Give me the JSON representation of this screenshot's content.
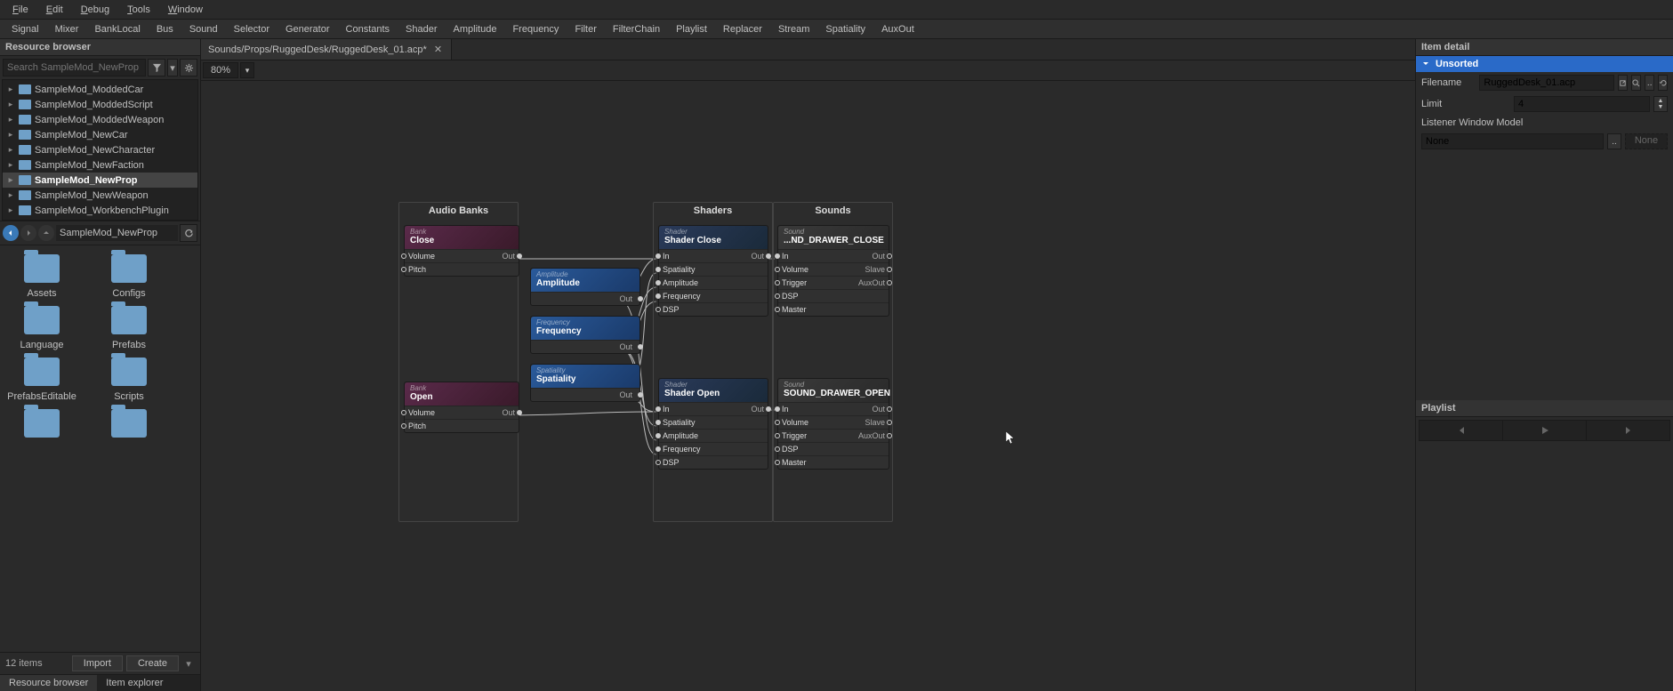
{
  "menu": {
    "file": "File",
    "edit": "Edit",
    "debug": "Debug",
    "tools": "Tools",
    "window": "Window"
  },
  "toolbar": [
    "Signal",
    "Mixer",
    "BankLocal",
    "Bus",
    "Sound",
    "Selector",
    "Generator",
    "Constants",
    "Shader",
    "Amplitude",
    "Frequency",
    "Filter",
    "FilterChain",
    "Playlist",
    "Replacer",
    "Stream",
    "Spatiality",
    "AuxOut"
  ],
  "left": {
    "panel_title": "Resource browser",
    "search_placeholder": "Search SampleMod_NewProp",
    "treeitems": [
      {
        "label": "SampleMod_ModdedCar",
        "sel": false
      },
      {
        "label": "SampleMod_ModdedScript",
        "sel": false
      },
      {
        "label": "SampleMod_ModdedWeapon",
        "sel": false
      },
      {
        "label": "SampleMod_NewCar",
        "sel": false
      },
      {
        "label": "SampleMod_NewCharacter",
        "sel": false
      },
      {
        "label": "SampleMod_NewFaction",
        "sel": false
      },
      {
        "label": "SampleMod_NewProp",
        "sel": true
      },
      {
        "label": "SampleMod_NewWeapon",
        "sel": false
      },
      {
        "label": "SampleMod_WorkbenchPlugin",
        "sel": false
      }
    ],
    "path": "SampleMod_NewProp",
    "folders": [
      "Assets",
      "Configs",
      "Language",
      "Prefabs",
      "PrefabsEditable",
      "Scripts"
    ],
    "count": "12 items",
    "import": "Import",
    "create": "Create",
    "tabs": {
      "rb": "Resource browser",
      "ie": "Item explorer"
    }
  },
  "center": {
    "tabpath": "Sounds/Props/RuggedDesk/RuggedDesk_01.acp*",
    "zoom": "80%",
    "groups": {
      "banks": "Audio Banks",
      "shaders": "Shaders",
      "sounds": "Sounds"
    },
    "nodes": {
      "bank_close": {
        "type": "Bank",
        "title": "Close",
        "rows": [
          {
            "l": "Volume",
            "r": "Out"
          },
          {
            "l": "Pitch",
            "r": ""
          }
        ]
      },
      "bank_open": {
        "type": "Bank",
        "title": "Open",
        "rows": [
          {
            "l": "Volume",
            "r": "Out"
          },
          {
            "l": "Pitch",
            "r": ""
          }
        ]
      },
      "amp": {
        "type": "Amplitude",
        "title": "Amplitude",
        "out": "Out"
      },
      "freq": {
        "type": "Frequency",
        "title": "Frequency",
        "out": "Out"
      },
      "spat": {
        "type": "Spatiality",
        "title": "Spatiality",
        "out": "Out"
      },
      "shader_close": {
        "type": "Shader",
        "title": "Shader Close",
        "rows": [
          "In",
          "Spatiality",
          "Amplitude",
          "Frequency",
          "DSP"
        ],
        "rout": "Out"
      },
      "shader_open": {
        "type": "Shader",
        "title": "Shader Open",
        "rows": [
          "In",
          "Spatiality",
          "Amplitude",
          "Frequency",
          "DSP"
        ],
        "rout": "Out"
      },
      "sound_close": {
        "type": "Sound",
        "title": "...ND_DRAWER_CLOSE",
        "rows": [
          {
            "l": "In",
            "r": "Out"
          },
          {
            "l": "Volume",
            "r": "Slave"
          },
          {
            "l": "Trigger",
            "r": "AuxOut"
          },
          {
            "l": "DSP",
            "r": ""
          },
          {
            "l": "Master",
            "r": ""
          }
        ]
      },
      "sound_open": {
        "type": "Sound",
        "title": "SOUND_DRAWER_OPEN",
        "rows": [
          {
            "l": "In",
            "r": "Out"
          },
          {
            "l": "Volume",
            "r": "Slave"
          },
          {
            "l": "Trigger",
            "r": "AuxOut"
          },
          {
            "l": "DSP",
            "r": ""
          },
          {
            "l": "Master",
            "r": ""
          }
        ]
      }
    }
  },
  "right": {
    "item_detail": "Item detail",
    "section": "Unsorted",
    "filename_lbl": "Filename",
    "filename_val": "RuggedDesk_01.acp",
    "limit_lbl": "Limit",
    "limit_val": "4",
    "lwm_lbl": "Listener Window Model",
    "lwm_val": "None",
    "lwm_none": "None",
    "playlist": "Playlist"
  }
}
